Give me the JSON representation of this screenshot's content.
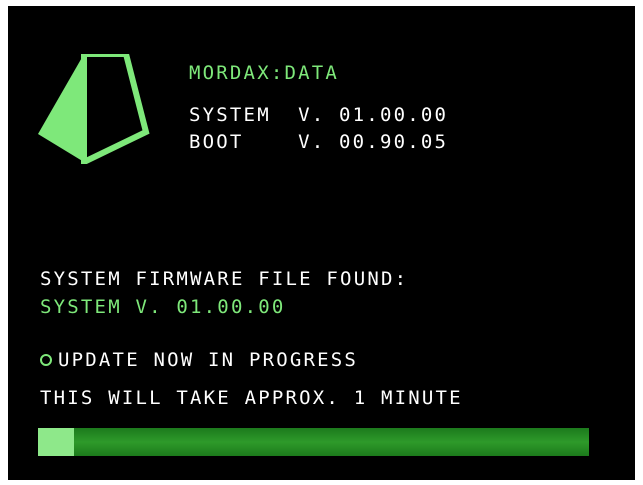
{
  "header": {
    "brand": "MORDAX:DATA",
    "system_version": "SYSTEM  V. 01.00.00",
    "boot_version": "BOOT    V. 00.90.05"
  },
  "firmware": {
    "found_label": "SYSTEM FIRMWARE FILE FOUND:",
    "found_value": "SYSTEM V. 01.00.00"
  },
  "status": {
    "progress_text": "UPDATE NOW IN PROGRESS",
    "duration_text": "THIS WILL TAKE APPROX. 1 MINUTE"
  },
  "progress": {
    "fraction": 0.065
  },
  "icons": {
    "logo": "prism-logo-icon",
    "status": "circle-bullet-icon"
  },
  "colors": {
    "background": "#000000",
    "accent_green": "#7ee87a",
    "text_white": "#ffffff",
    "bar_track": "#2e9a2a",
    "bar_fill": "#8ee88a"
  }
}
